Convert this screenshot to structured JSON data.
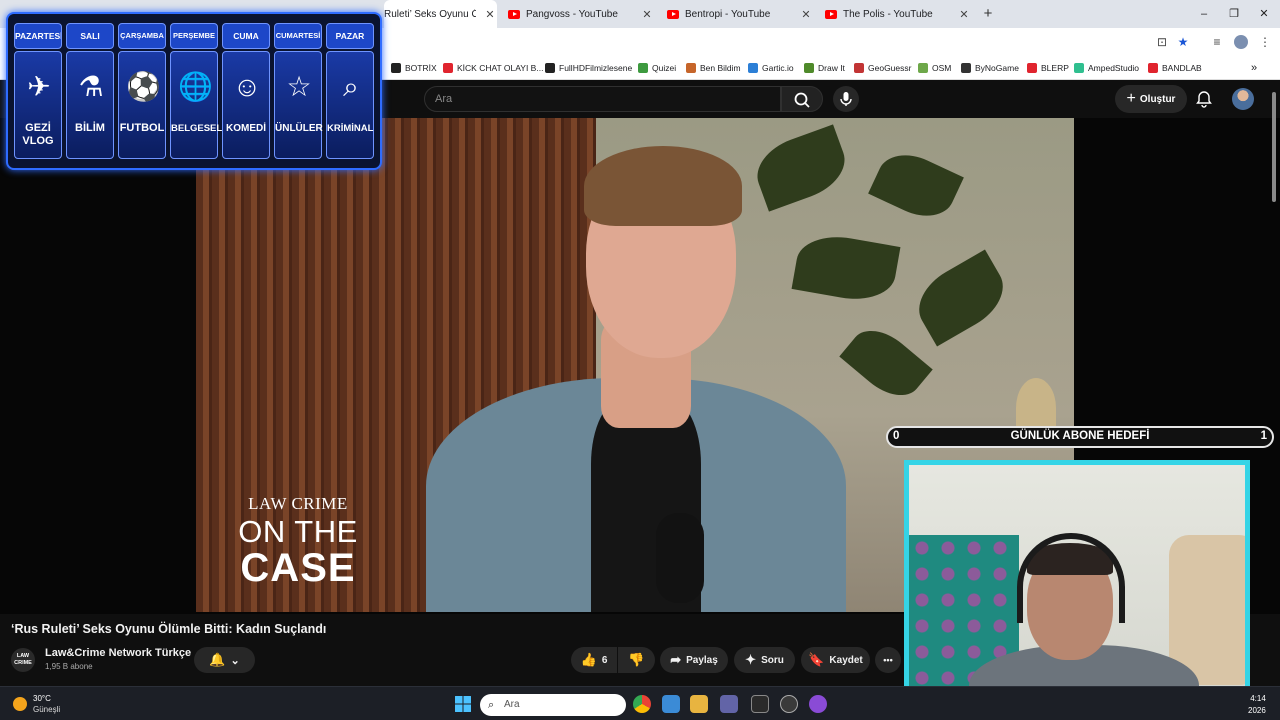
{
  "browser": {
    "tabs": [
      {
        "title": "Ruleti’ Seks Oyunu Ölümle",
        "active": true
      },
      {
        "title": "Pangvoss - YouTube",
        "active": false
      },
      {
        "title": "Bentropi - YouTube",
        "active": false
      },
      {
        "title": "The Polis - YouTube",
        "active": false
      }
    ],
    "new_tab": "+",
    "window_controls": {
      "minimize": "–",
      "maximize": "❐",
      "close": "✕"
    },
    "bookmarks": [
      {
        "label": "BOTRİX",
        "color": "#222222"
      },
      {
        "label": "KİCK CHAT OLAYI B...",
        "color": "#e0242e"
      },
      {
        "label": "FullHDFilmizlesene",
        "color": "#222222"
      },
      {
        "label": "Quizei",
        "color": "#3d9a3f"
      },
      {
        "label": "Ben Bildim",
        "color": "#c6652a"
      },
      {
        "label": "Gartic.io",
        "color": "#2c7fd6"
      },
      {
        "label": "Draw It",
        "color": "#4f8a2a"
      },
      {
        "label": "GeoGuessr",
        "color": "#c23434"
      },
      {
        "label": "OSM",
        "color": "#6ea84a"
      },
      {
        "label": "ByNoGame",
        "color": "#333333"
      },
      {
        "label": "BLERP",
        "color": "#e0242e"
      },
      {
        "label": "AmpedStudio",
        "color": "#2fbf8f"
      },
      {
        "label": "BANDLAB",
        "color": "#e0242e"
      }
    ],
    "bookmarks_more": "»"
  },
  "youtube": {
    "search_placeholder": "Ara",
    "create_label": "Oluştur",
    "video_title": "‘Rus Ruleti’ Seks Oyunu Ölümle Bitti: Kadın Suçlandı",
    "channel_logo_text": "LAW CRIME",
    "channel_name": "Law&Crime Network Türkçe",
    "channel_subs": "1,95 B abone",
    "like_count": "6",
    "share_label": "Paylaş",
    "ask_label": "Soru",
    "save_label": "Kaydet",
    "more_label": "•••"
  },
  "video_overlay": {
    "brand_line1": "LAW CRIME",
    "brand_line2": "ON THE",
    "brand_line3": "CASE"
  },
  "schedule": {
    "days": [
      {
        "day": "PAZARTESİ",
        "label": "GEZİ VLOG",
        "icon": "globe-plane-icon",
        "glyph": "✈"
      },
      {
        "day": "SALI",
        "label": "BİLİM",
        "icon": "science-icon",
        "glyph": "⚗"
      },
      {
        "day": "ÇARŞAMBA",
        "label": "FUTBOL",
        "icon": "football-icon",
        "glyph": "⚽"
      },
      {
        "day": "PERŞEMBE",
        "label": "BELGESEL",
        "icon": "earth-icon",
        "glyph": "🌐"
      },
      {
        "day": "CUMA",
        "label": "KOMEDİ",
        "icon": "comedy-mask-icon",
        "glyph": "☺"
      },
      {
        "day": "CUMARTESİ",
        "label": "ÜNLÜLER",
        "icon": "star-icon",
        "glyph": "☆"
      },
      {
        "day": "PAZAR",
        "label": "KRİMİNAL",
        "icon": "fingerprint-search-icon",
        "glyph": "⌕"
      }
    ]
  },
  "sub_goal": {
    "current": "0",
    "label": "GÜNLÜK ABONE HEDEFİ",
    "target": "1"
  },
  "taskbar": {
    "temperature": "30°C",
    "weather": "Güneşli",
    "search_placeholder": "Ara",
    "time": "4:14",
    "date": "2026"
  },
  "colors": {
    "accent_blue": "#2f6cff",
    "cam_border": "#35d4e6",
    "yt_bg": "#0f0f0f"
  }
}
